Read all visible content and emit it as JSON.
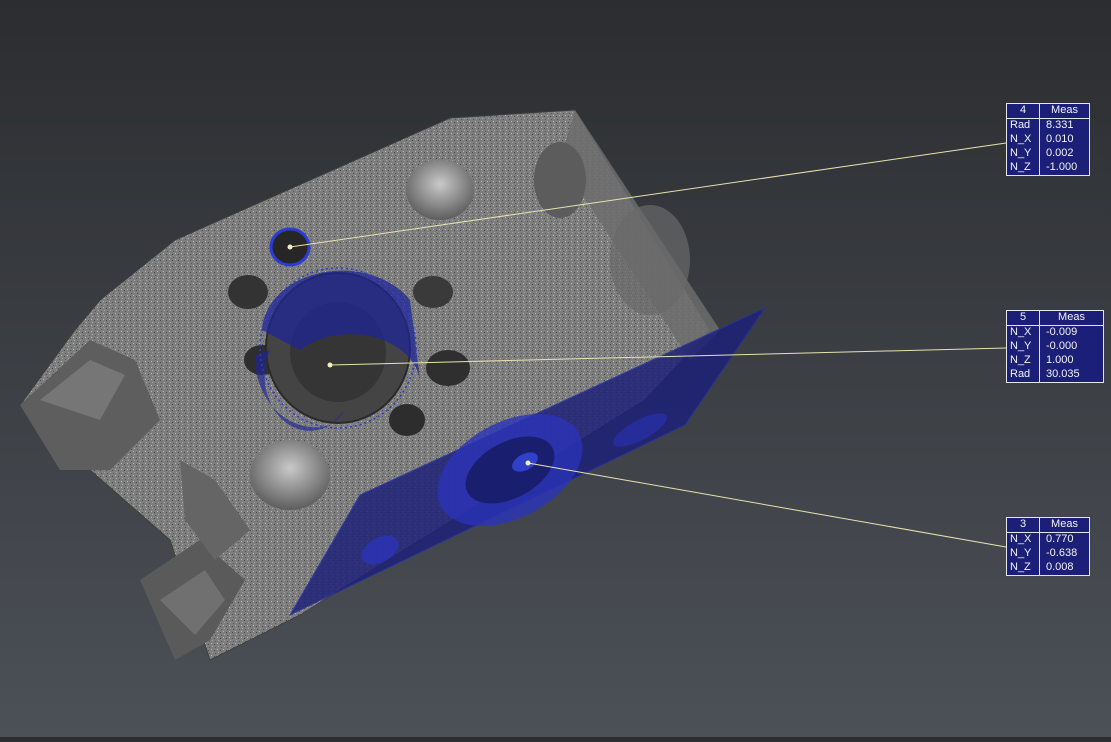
{
  "scene": {
    "background_top": "#2b2d30",
    "background_bottom": "#4c5157",
    "part_color": "#8c8c8c",
    "highlight_color": "#1c1f78",
    "leader_color": "#e8e2b0"
  },
  "labels": [
    {
      "id": "4",
      "title": "Meas",
      "rows": [
        {
          "key": "Rad",
          "value": "8.331"
        },
        {
          "key": "N_X",
          "value": "0.010"
        },
        {
          "key": "N_Y",
          "value": "0.002"
        },
        {
          "key": "N_Z",
          "value": "-1.000"
        }
      ]
    },
    {
      "id": "5",
      "title": "Meas",
      "rows": [
        {
          "key": "N_X",
          "value": "-0.009"
        },
        {
          "key": "N_Y",
          "value": "-0.000"
        },
        {
          "key": "N_Z",
          "value": "1.000"
        },
        {
          "key": "Rad",
          "value": "30.035"
        }
      ]
    },
    {
      "id": "3",
      "title": "Meas",
      "rows": [
        {
          "key": "N_X",
          "value": "0.770"
        },
        {
          "key": "N_Y",
          "value": "-0.638"
        },
        {
          "key": "N_Z",
          "value": "0.008"
        }
      ]
    }
  ]
}
